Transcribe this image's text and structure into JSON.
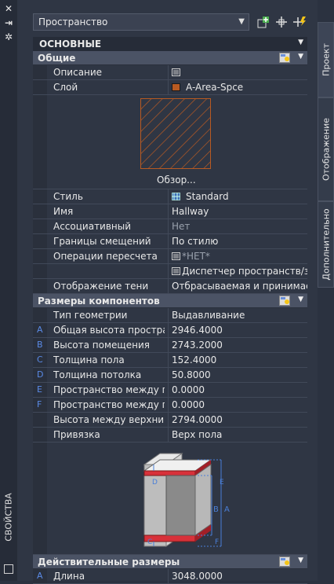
{
  "palette_title": "СВОЙСТВА",
  "category_dropdown": {
    "value": "Пространство"
  },
  "tabs": [
    "Проект",
    "Отображение",
    "Дополнительно"
  ],
  "top_section": "ОСНОВНЫЕ",
  "general": {
    "title": "Общие",
    "rows": [
      {
        "label": "Описание",
        "value": ""
      },
      {
        "label": "Слой",
        "value": "A-Area-Spce"
      }
    ],
    "preview_label": "Обзор...",
    "rows2": [
      {
        "label": "Стиль",
        "value": "Standard"
      },
      {
        "label": "Имя",
        "value": "Hallway"
      },
      {
        "label": "Ассоциативный",
        "value": "Нет"
      },
      {
        "label": "Границы смещений",
        "value": "По стилю"
      },
      {
        "label": "Операции пересчета",
        "value": "*НЕТ*"
      },
      {
        "label": "",
        "value": "Диспетчер пространств/з..."
      },
      {
        "label": "Отображение тени",
        "value": "Отбрасываемая и принимае..."
      }
    ]
  },
  "components": {
    "title": "Размеры компонентов",
    "rows": [
      {
        "letter": "",
        "label": "Тип геометрии",
        "value": "Выдавливание"
      },
      {
        "letter": "A",
        "label": "Общая высота простра...",
        "value": "2946.4000"
      },
      {
        "letter": "B",
        "label": "Высота помещения",
        "value": "2743.2000"
      },
      {
        "letter": "C",
        "label": "Толщина пола",
        "value": "152.4000"
      },
      {
        "letter": "D",
        "label": "Толщина потолка",
        "value": "50.8000"
      },
      {
        "letter": "E",
        "label": "Пространство между п...",
        "value": "0.0000"
      },
      {
        "letter": "F",
        "label": "Пространство между п...",
        "value": "0.0000"
      },
      {
        "letter": "",
        "label": "Высота между верхним...",
        "value": "2794.0000"
      },
      {
        "letter": "",
        "label": "Привязка",
        "value": "Верх пола"
      }
    ],
    "diagram_labels": [
      "D",
      "E",
      "B",
      "A",
      "C",
      "F"
    ]
  },
  "actual": {
    "title": "Действительные размеры",
    "rows": [
      {
        "letter": "A",
        "label": "Длина",
        "value": "3048.0000"
      }
    ]
  },
  "colors": {
    "layer_swatch": "#b85a22",
    "accent_red": "#d8313a",
    "dim_blue": "#5a8ae6"
  }
}
